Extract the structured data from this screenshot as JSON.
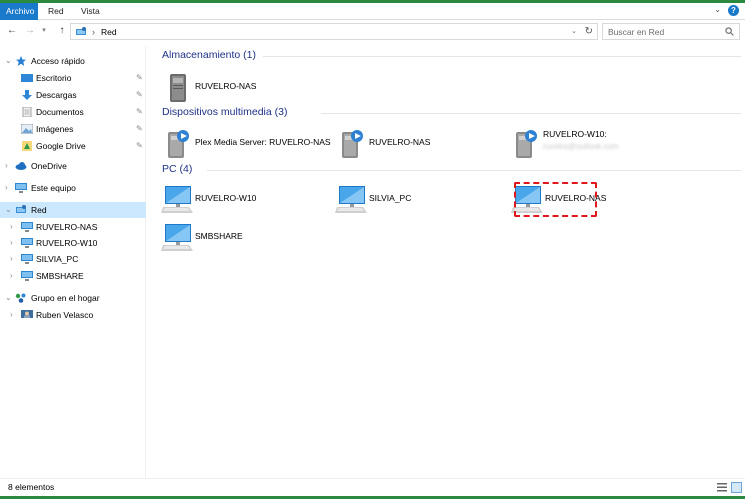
{
  "ribbon": {
    "tabs": [
      "Archivo",
      "Red",
      "Vista"
    ],
    "help_label": "?"
  },
  "address": {
    "crumb": "Red",
    "search_placeholder": "Buscar en Red"
  },
  "sidebar": {
    "items": [
      {
        "label": "Acceso rápido",
        "icon": "star-icon"
      },
      {
        "label": "Escritorio",
        "icon": "desktop-folder-icon",
        "pinned": true
      },
      {
        "label": "Descargas",
        "icon": "download-arrow-icon",
        "pinned": true
      },
      {
        "label": "Documentos",
        "icon": "documents-icon",
        "pinned": true
      },
      {
        "label": "Imágenes",
        "icon": "pictures-icon",
        "pinned": true
      },
      {
        "label": "Google Drive",
        "icon": "google-drive-icon",
        "pinned": true
      },
      {
        "label": "OneDrive",
        "icon": "onedrive-cloud-icon"
      },
      {
        "label": "Este equipo",
        "icon": "computer-icon"
      },
      {
        "label": "Red",
        "icon": "network-icon",
        "selected": true
      },
      {
        "label": "RUVELRO-NAS",
        "icon": "computer-icon"
      },
      {
        "label": "RUVELRO-W10",
        "icon": "computer-icon"
      },
      {
        "label": "SILVIA_PC",
        "icon": "computer-icon"
      },
      {
        "label": "SMBSHARE",
        "icon": "computer-icon"
      },
      {
        "label": "Grupo en el hogar",
        "icon": "homegroup-icon"
      },
      {
        "label": "Ruben Velasco",
        "icon": "user-computer-icon"
      }
    ]
  },
  "content": {
    "groups": [
      {
        "header": "Almacenamiento (1)",
        "items": [
          {
            "label": "RUVELRO-NAS",
            "icon": "nas-storage-icon"
          }
        ]
      },
      {
        "header": "Dispositivos multimedia (3)",
        "items": [
          {
            "label": "Plex Media Server: RUVELRO-NAS",
            "icon": "media-server-icon"
          },
          {
            "label": "RUVELRO-NAS",
            "icon": "media-server-icon"
          },
          {
            "label": "RUVELRO-W10:",
            "sub": "ruvelro@outlook.com",
            "icon": "media-server-icon"
          }
        ]
      },
      {
        "header": "PC (4)",
        "items": [
          {
            "label": "RUVELRO-W10",
            "icon": "computer-icon"
          },
          {
            "label": "SILVIA_PC",
            "icon": "computer-icon"
          },
          {
            "label": "RUVELRO-NAS",
            "icon": "computer-icon",
            "highlighted": true
          },
          {
            "label": "SMBSHARE",
            "icon": "computer-icon"
          }
        ]
      }
    ]
  },
  "status": {
    "count": "8 elementos"
  },
  "colors": {
    "accent": "#1979ca",
    "selection": "#cce8ff",
    "group_header": "#1e3287",
    "highlight_border": "#e0171d"
  }
}
